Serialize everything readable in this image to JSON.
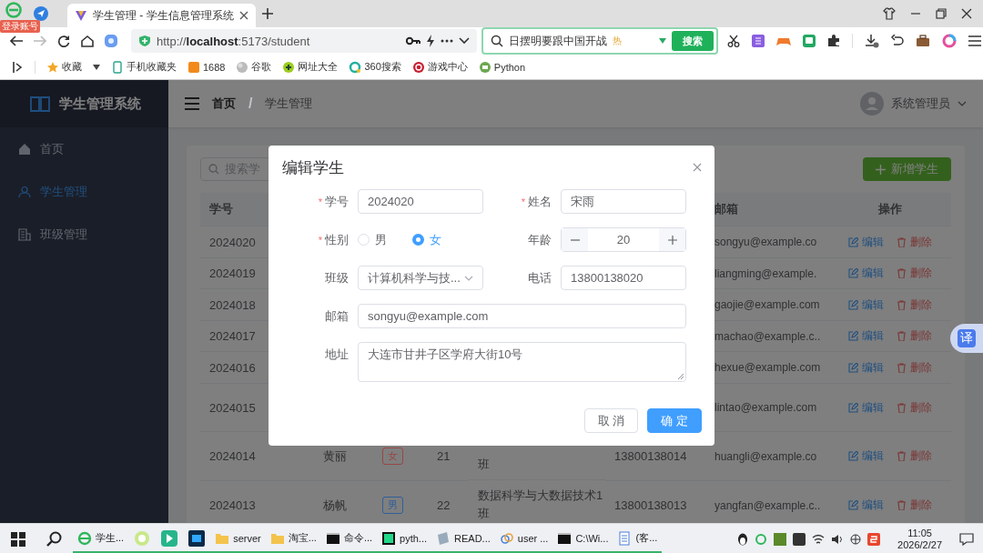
{
  "browser": {
    "login_badge": "登录账号",
    "tabs": [
      {
        "title": "学生管理 - 学生信息管理系统",
        "selected": true
      }
    ],
    "address": "http://**localhost**:5173/student",
    "search": {
      "value": "日摆明要跟中国开战",
      "hot_badge": "热",
      "button": "搜索"
    },
    "bookmarks": [
      {
        "label": "收藏"
      },
      {
        "label": "手机收藏夹"
      },
      {
        "label": "1688"
      },
      {
        "label": "谷歌"
      },
      {
        "label": "网址大全"
      },
      {
        "label": "360搜索"
      },
      {
        "label": "游戏中心"
      },
      {
        "label": "Python"
      }
    ]
  },
  "sidebar": {
    "title": "学生管理系统",
    "items": [
      {
        "label": "首页",
        "selected": false
      },
      {
        "label": "学生管理",
        "selected": true
      },
      {
        "label": "班级管理",
        "selected": false
      }
    ]
  },
  "header": {
    "breadcrumb": [
      "首页",
      "学生管理"
    ],
    "separator": "/",
    "user": "系统管理员"
  },
  "toolbar": {
    "search_placeholder": "搜索学",
    "add_button": "新增学生"
  },
  "table": {
    "columns": [
      "学号",
      "邮箱",
      "操作"
    ],
    "rows": [
      {
        "id": "2024020",
        "email": "songyu@example.co",
        "actions": [
          "编辑",
          "删除"
        ]
      },
      {
        "id": "2024019",
        "email": "liangming@example.",
        "actions": [
          "编辑",
          "删除"
        ]
      },
      {
        "id": "2024018",
        "email": "gaojie@example.com",
        "actions": [
          "编辑",
          "删除"
        ]
      },
      {
        "id": "2024017",
        "email": "machao@example.c..",
        "actions": [
          "编辑",
          "删除"
        ]
      },
      {
        "id": "2024016",
        "email": "hexue@example.com",
        "actions": [
          "编辑",
          "删除"
        ]
      },
      {
        "id": "2024015",
        "email": "lintao@example.com",
        "actions": [
          "编辑",
          "删除"
        ]
      },
      {
        "id": "2024014",
        "name": "黄丽",
        "gender": {
          "label": "女",
          "color": "#9b4545"
        },
        "age": "21",
        "class": "班",
        "phone": "13800138014",
        "email": "huangli@example.co",
        "actions": [
          "编辑",
          "删除"
        ]
      },
      {
        "id": "2024013",
        "name": "杨帆",
        "gender": {
          "label": "男",
          "color": "#2f5f9a"
        },
        "age": "22",
        "class": "数据科学与大数据技术1班",
        "phone": "13800138013",
        "email": "yangfan@example.c..",
        "actions": [
          "编辑",
          "删除"
        ]
      }
    ]
  },
  "dialog": {
    "title": "编辑学生",
    "fields": [
      {
        "kind": "text",
        "required_mark": "*",
        "label": "学号",
        "value": "2024020"
      },
      {
        "kind": "text",
        "required_mark": "*",
        "label": "姓名",
        "value": "宋雨"
      },
      {
        "kind": "radio",
        "required_mark": "*",
        "label": "性别",
        "options": [
          {
            "label": "男",
            "selected": false
          },
          {
            "label": "女",
            "selected": true
          }
        ]
      },
      {
        "kind": "number",
        "label": "年龄",
        "value": "20"
      },
      {
        "kind": "select",
        "label": "班级",
        "value": "计算机科学与技..."
      },
      {
        "kind": "text",
        "label": "电话",
        "value": "13800138020"
      },
      {
        "kind": "wide",
        "label": "邮箱",
        "value": "songyu@example.com"
      },
      {
        "kind": "textarea",
        "label": "地址",
        "value": "大连市甘井子区学府大街10号"
      }
    ],
    "buttons": [
      {
        "label": "取 消",
        "kind": "default"
      },
      {
        "label": "确 定",
        "kind": "primary"
      }
    ]
  },
  "translate_button": "译",
  "taskbar": {
    "items": [
      "学生...",
      "server",
      "淘宝...",
      "命令...",
      "pyth...",
      "READ...",
      "user ...",
      "C:\\Wi...",
      "(客..."
    ],
    "time": "11:05",
    "date": "2026/2/27"
  }
}
